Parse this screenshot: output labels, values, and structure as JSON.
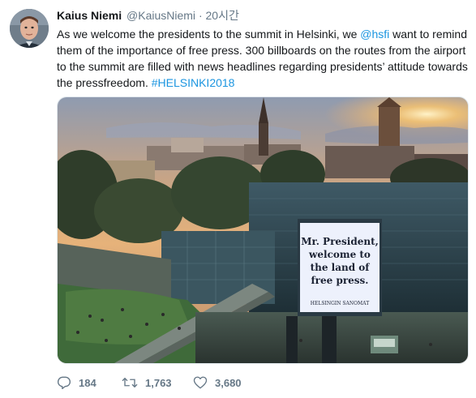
{
  "tweet": {
    "author_name": "Kaius Niemi",
    "author_handle": "@KaiusNiemi",
    "separator": "·",
    "timestamp": "20시간",
    "text_part1": "As we welcome the presidents to the summit in Helsinki, we ",
    "mention": "@hsfi",
    "text_part2": " want to remind them of the importance of free press. 300 billboards on the routes from the airport to the summit are filled with news headlines regarding presidents’ attitude towards the pressfreedom. ",
    "hashtag": "#HELSINKI2018",
    "link_color": "#1b95e0"
  },
  "media": {
    "billboard_lines": [
      "Mr. President,",
      "welcome to",
      "the land of",
      "free press."
    ],
    "billboard_brand": "HELSINGIN SANOMAT"
  },
  "actions": {
    "replies": "184",
    "retweets": "1,763",
    "likes": "3,680",
    "reply_icon": "reply-icon",
    "retweet_icon": "retweet-icon",
    "like_icon": "heart-icon"
  }
}
